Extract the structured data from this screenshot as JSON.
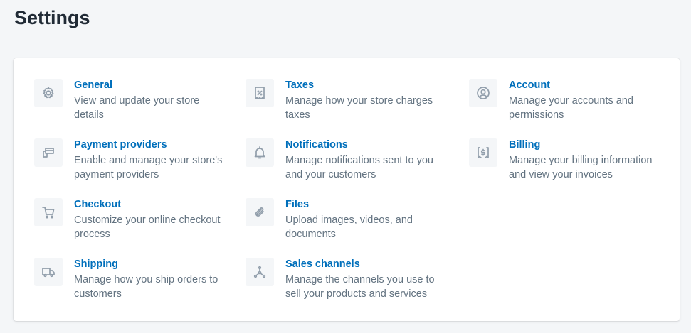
{
  "page_title": "Settings",
  "items": [
    {
      "title": "General",
      "desc": "View and update your store details",
      "icon": "gear-icon"
    },
    {
      "title": "Payment providers",
      "desc": "Enable and manage your store's payment providers",
      "icon": "payment-icon"
    },
    {
      "title": "Checkout",
      "desc": "Customize your online checkout process",
      "icon": "cart-icon"
    },
    {
      "title": "Shipping",
      "desc": "Manage how you ship orders to customers",
      "icon": "truck-icon"
    },
    {
      "title": "Taxes",
      "desc": "Manage how your store charges taxes",
      "icon": "tax-receipt-icon"
    },
    {
      "title": "Notifications",
      "desc": "Manage notifications sent to you and your customers",
      "icon": "bell-icon"
    },
    {
      "title": "Files",
      "desc": "Upload images, videos, and documents",
      "icon": "paperclip-icon"
    },
    {
      "title": "Sales channels",
      "desc": "Manage the channels you use to sell your products and services",
      "icon": "channels-icon"
    },
    {
      "title": "Account",
      "desc": "Manage your accounts and permissions",
      "icon": "account-icon"
    },
    {
      "title": "Billing",
      "desc": "Manage your billing information and view your invoices",
      "icon": "billing-icon"
    }
  ]
}
